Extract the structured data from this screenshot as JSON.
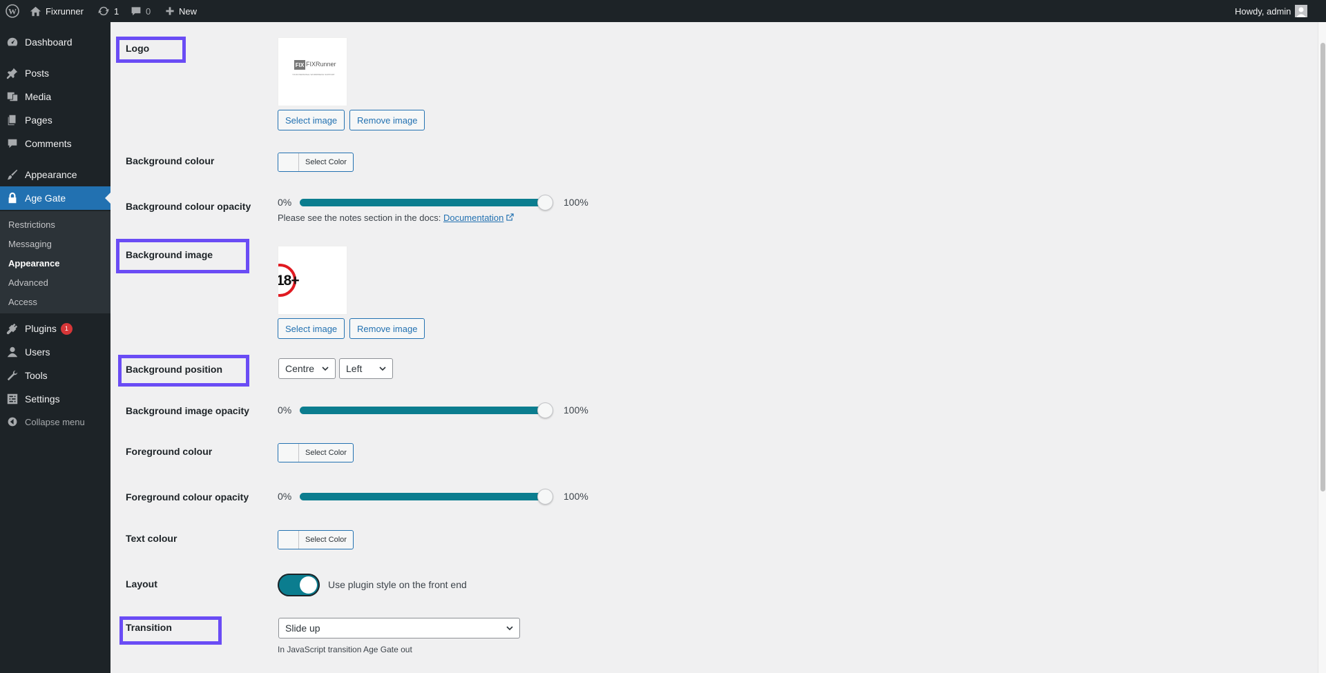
{
  "admin_bar": {
    "site_name": "Fixrunner",
    "updates_count": "1",
    "comments_count": "0",
    "new_label": "New",
    "howdy": "Howdy, admin"
  },
  "sidebar": {
    "items": [
      {
        "label": "Dashboard"
      },
      {
        "label": "Posts"
      },
      {
        "label": "Media"
      },
      {
        "label": "Pages"
      },
      {
        "label": "Comments"
      },
      {
        "label": "Appearance"
      },
      {
        "label": "Age Gate"
      },
      {
        "label": "Plugins",
        "badge": "1"
      },
      {
        "label": "Users"
      },
      {
        "label": "Tools"
      },
      {
        "label": "Settings"
      }
    ],
    "submenu": [
      "Restrictions",
      "Messaging",
      "Appearance",
      "Advanced",
      "Access"
    ],
    "collapse_label": "Collapse menu"
  },
  "settings": {
    "logo": {
      "label": "Logo",
      "preview_text": "FIXRunner",
      "preview_tagline": "YOUR PERSONAL WORDPRESS SUPPORT TEAM",
      "select_btn": "Select image",
      "remove_btn": "Remove image"
    },
    "bg_colour": {
      "label": "Background colour",
      "button": "Select Color"
    },
    "bg_colour_opacity": {
      "label": "Background colour opacity",
      "min": "0%",
      "max": "100%",
      "value": 1.0,
      "note_prefix": "Please see the notes section in the docs:",
      "note_link": "Documentation"
    },
    "bg_image": {
      "label": "Background image",
      "preview_text": "18+",
      "select_btn": "Select image",
      "remove_btn": "Remove image"
    },
    "bg_position": {
      "label": "Background position",
      "vertical": "Centre",
      "horizontal": "Left"
    },
    "bg_image_opacity": {
      "label": "Background image opacity",
      "min": "0%",
      "max": "100%",
      "value": 1.0
    },
    "fg_colour": {
      "label": "Foreground colour",
      "button": "Select Color"
    },
    "fg_colour_opacity": {
      "label": "Foreground colour opacity",
      "min": "0%",
      "max": "100%",
      "value": 1.0
    },
    "text_colour": {
      "label": "Text colour",
      "button": "Select Color"
    },
    "layout": {
      "label": "Layout",
      "toggle_text": "Use plugin style on the front end",
      "enabled": true
    },
    "transition": {
      "label": "Transition",
      "value": "Slide up",
      "help": "In JavaScript transition Age Gate out"
    }
  },
  "colors": {
    "admin_dark": "#1d2327",
    "accent_blue": "#2271b1",
    "slider_teal": "#0b7d8f",
    "highlight_purple": "#6a4cf5",
    "badge_red": "#d63638"
  },
  "icons": [
    "wordpress-logo-icon",
    "home-icon",
    "updates-icon",
    "comment-bubble-icon",
    "plus-icon",
    "avatar-icon",
    "dashboard-icon",
    "pin-icon",
    "media-icon",
    "pages-icon",
    "comments-icon",
    "brush-icon",
    "lock-icon",
    "plugins-icon",
    "users-icon",
    "tools-icon",
    "settings-icon",
    "collapse-icon",
    "external-link-icon",
    "chevron-down-icon"
  ]
}
